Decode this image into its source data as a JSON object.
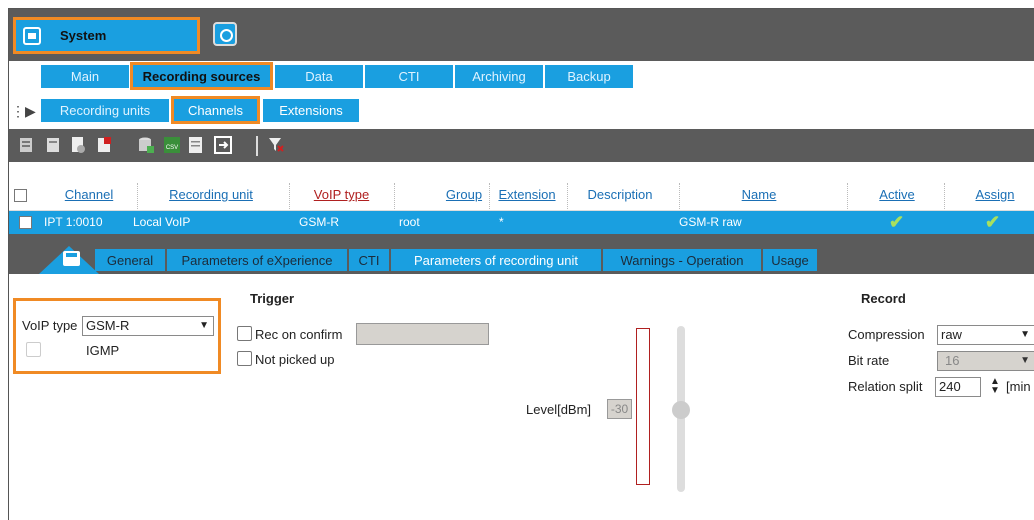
{
  "header": {
    "system_label": "System"
  },
  "main_tabs": [
    "Main",
    "Recording sources",
    "Data",
    "CTI",
    "Archiving",
    "Backup"
  ],
  "sub_tabs": [
    "Recording units",
    "Channels",
    "Extensions"
  ],
  "toolbar": {
    "csv_label": "CSV"
  },
  "grid": {
    "columns": [
      "Channel",
      "Recording unit",
      "VoIP type",
      "Group",
      "Extension",
      "Description",
      "Name",
      "Active",
      "Assign"
    ],
    "row": {
      "channel": "IPT 1:0010",
      "recording_unit": "Local VoIP",
      "voip_type": "GSM-R",
      "group": "root",
      "extension": "*",
      "description": "",
      "name": "GSM-R raw",
      "active": "✔",
      "assign": "✔"
    }
  },
  "detail_tabs": [
    "General",
    "Parameters of eXperience",
    "CTI",
    "Parameters of recording unit",
    "Warnings - Operation",
    "Usage"
  ],
  "panel": {
    "trigger_title": "Trigger",
    "record_title": "Record",
    "voip_type_label": "VoIP type",
    "voip_type_value": "GSM-R",
    "igmp_label": "IGMP",
    "rec_on_confirm_label": "Rec on confirm",
    "not_picked_up_label": "Not picked up",
    "level_label": "Level[dBm]",
    "level_value": "-30",
    "compression_label": "Compression",
    "compression_value": "raw",
    "bit_rate_label": "Bit rate",
    "bit_rate_value": "16",
    "relation_split_label": "Relation split",
    "relation_split_value": "240",
    "relation_split_unit": "[min"
  },
  "colors": {
    "accent": "#1a9fe0",
    "highlight": "#f08a24",
    "bar": "#5b5b5b",
    "check": "#a8e05f"
  }
}
